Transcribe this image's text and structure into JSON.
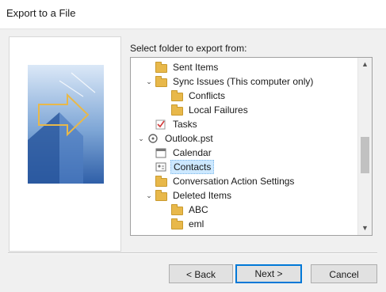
{
  "window": {
    "title": "Export to a File"
  },
  "prompt": "Select folder to export from:",
  "tree": {
    "items": [
      {
        "label": "Sent Items",
        "icon": "folder-icon",
        "level": 2,
        "expander": ""
      },
      {
        "label": "Sync Issues (This computer only)",
        "icon": "sync-folder-icon",
        "level": 2,
        "expander": "expanded"
      },
      {
        "label": "Conflicts",
        "icon": "folder-icon",
        "level": 3,
        "expander": ""
      },
      {
        "label": "Local Failures",
        "icon": "folder-icon",
        "level": 3,
        "expander": ""
      },
      {
        "label": "Tasks",
        "icon": "tasks-icon",
        "level": 2,
        "expander": ""
      },
      {
        "label": "Outlook.pst",
        "icon": "data-file-icon",
        "level": 1,
        "expander": "expanded"
      },
      {
        "label": "Calendar",
        "icon": "calendar-icon",
        "level": 2,
        "expander": ""
      },
      {
        "label": "Contacts",
        "icon": "contacts-icon",
        "level": 2,
        "expander": "",
        "selected": true
      },
      {
        "label": "Conversation Action Settings",
        "icon": "folder-icon",
        "level": 2,
        "expander": ""
      },
      {
        "label": "Deleted Items",
        "icon": "recycle-folder-icon",
        "level": 2,
        "expander": "expanded"
      },
      {
        "label": "ABC",
        "icon": "folder-icon",
        "level": 3,
        "expander": ""
      },
      {
        "label": "eml",
        "icon": "folder-icon",
        "level": 3,
        "expander": ""
      }
    ]
  },
  "buttons": {
    "back": "< Back",
    "next": "Next >",
    "cancel": "Cancel"
  },
  "colors": {
    "accent": "#0078d7",
    "selection": "#cce8ff",
    "folder": "#e8b84a"
  }
}
